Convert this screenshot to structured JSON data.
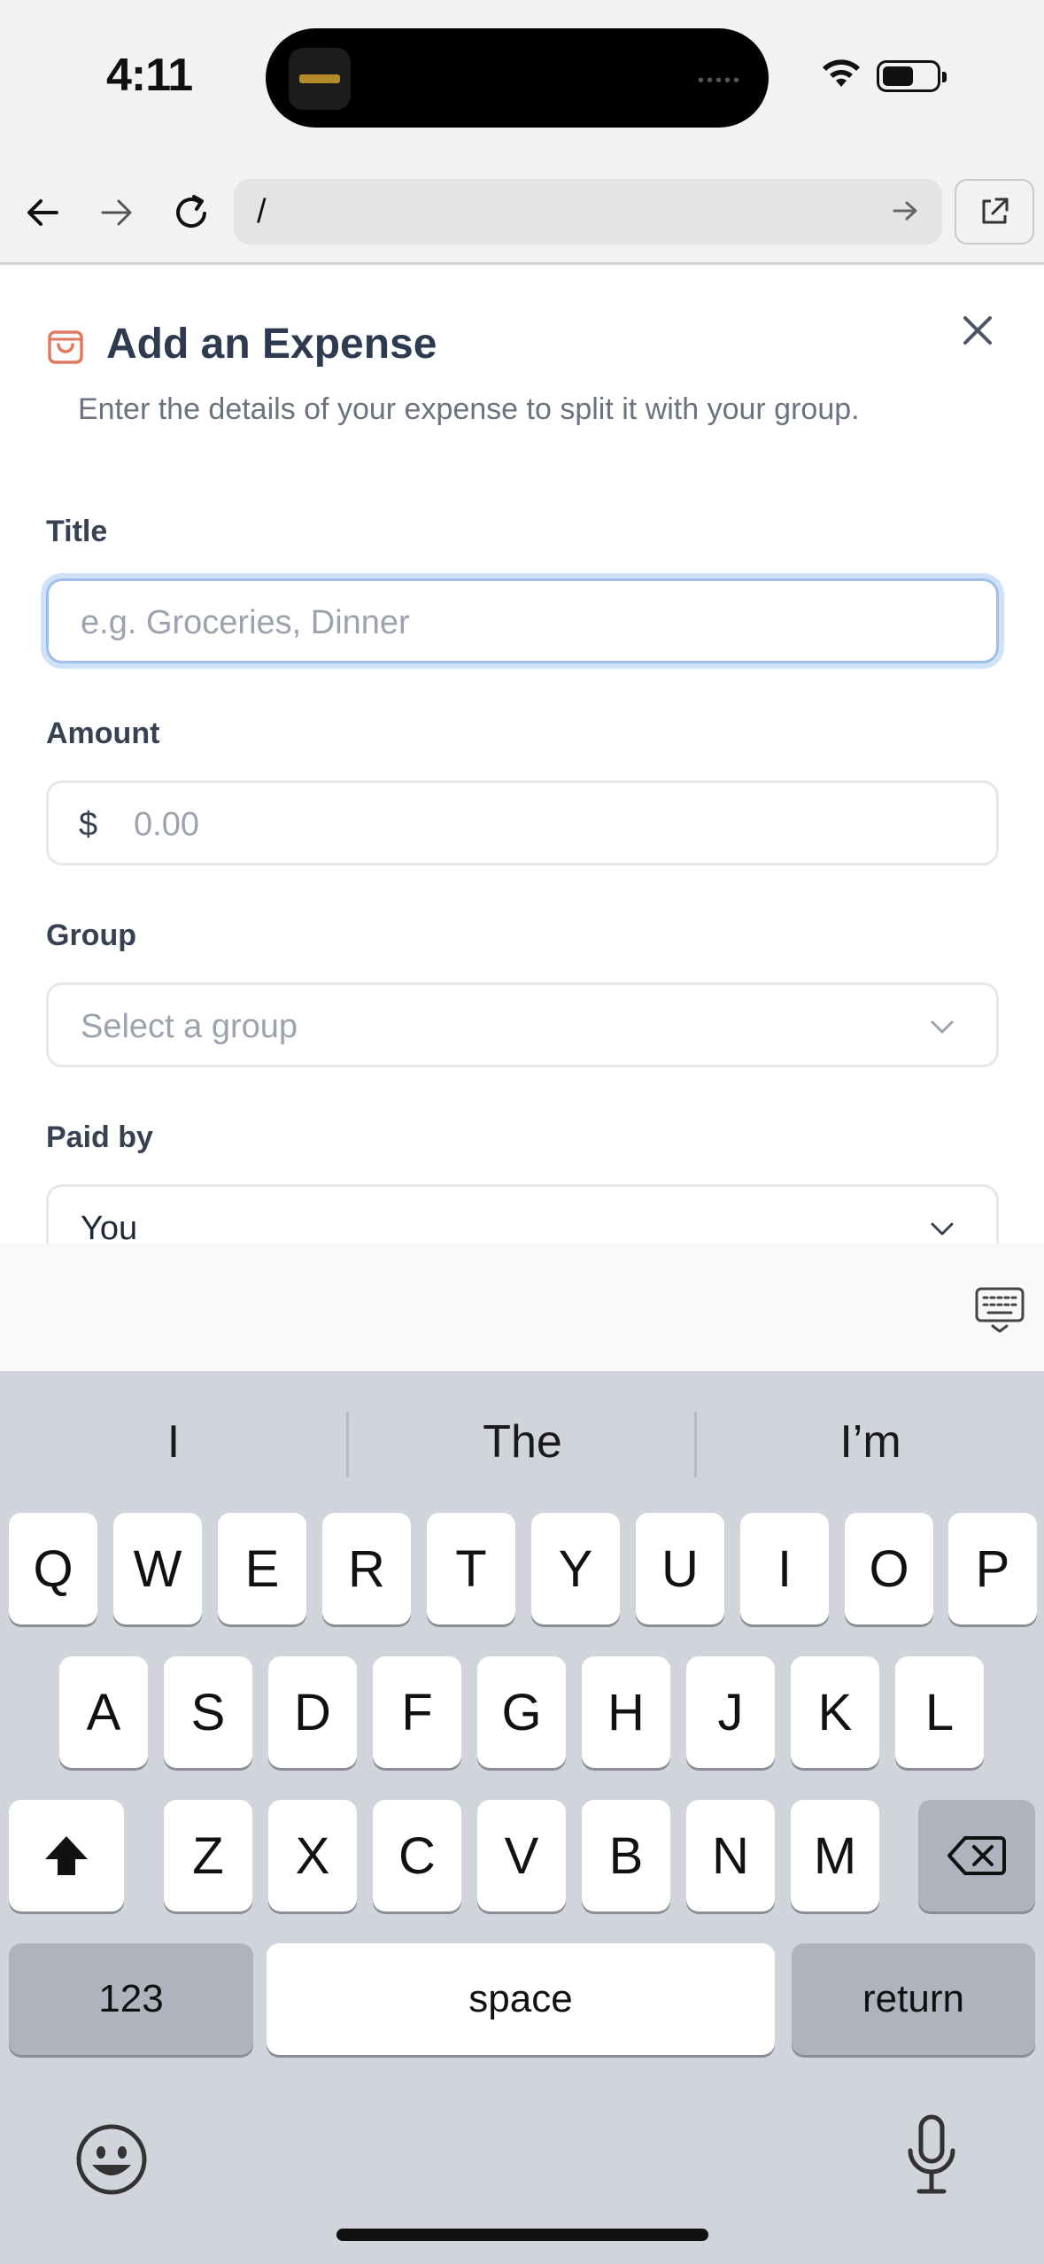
{
  "status_bar": {
    "time": "4:11"
  },
  "browser": {
    "url": "/"
  },
  "modal": {
    "title": "Add an Expense",
    "subtitle": "Enter the details of your expense to split it with your group.",
    "fields": {
      "title_label": "Title",
      "title_placeholder": "e.g. Groceries, Dinner",
      "amount_label": "Amount",
      "currency_symbol": "$",
      "amount_placeholder": "0.00",
      "group_label": "Group",
      "group_placeholder": "Select a group",
      "paid_by_label": "Paid by",
      "paid_by_value": "You"
    }
  },
  "keyboard": {
    "predictions": [
      "I",
      "The",
      "I’m"
    ],
    "row1": [
      "Q",
      "W",
      "E",
      "R",
      "T",
      "Y",
      "U",
      "I",
      "O",
      "P"
    ],
    "row2": [
      "A",
      "S",
      "D",
      "F",
      "G",
      "H",
      "J",
      "K",
      "L"
    ],
    "row3": [
      "Z",
      "X",
      "C",
      "V",
      "B",
      "N",
      "M"
    ],
    "numbers_label": "123",
    "space_label": "space",
    "return_label": "return"
  },
  "icons": {
    "accent": "#e07a5f",
    "focus_ring": "#9fbfe6"
  }
}
